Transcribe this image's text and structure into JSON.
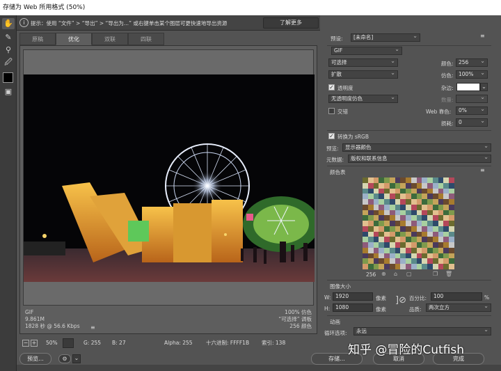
{
  "window": {
    "title": "存储为 Web 所用格式 (50%)"
  },
  "hint": {
    "text": "提示：使用 “文件” > “导出” > “导出为...” 或右键单击某个图层可更快速地导出资源",
    "learn_more": "了解更多"
  },
  "tabs": [
    {
      "label": "原稿"
    },
    {
      "label": "优化"
    },
    {
      "label": "双联"
    },
    {
      "label": "四联"
    }
  ],
  "preview_info": {
    "left": [
      "GIF",
      "9.861M",
      "1828 秒 @ 56.6 Kbps"
    ],
    "right": [
      "100% 仿色",
      "“可选择” 调板",
      "256 颜色"
    ],
    "menu_icon": "menu-icon"
  },
  "status": {
    "zoom": "50%",
    "g": "G: 255",
    "b": "B: 27",
    "alpha": "Alpha: 255",
    "hex": "十六进制: FFFF1B",
    "index": "索引: 138"
  },
  "buttons": {
    "preview": "预览...",
    "save": "存储...",
    "cancel": "取消",
    "done": "完成"
  },
  "settings": {
    "preset_label": "预设:",
    "preset_value": "[未命名]",
    "format": "GIF",
    "reduction": "可选择",
    "colors_label": "颜色:",
    "colors_value": "256",
    "dither_algo": "扩散",
    "dither_label": "仿色:",
    "dither_value": "100%",
    "transparency_label": "透明度",
    "matte_label": "杂边:",
    "trans_dither": "无透明度仿色",
    "amount_label": "数量:",
    "interlaced_label": "交错",
    "web_snap_label": "Web 靠色:",
    "web_snap_value": "0%",
    "lossy_label": "损耗:",
    "lossy_value": "0",
    "srgb_label": "转换为 sRGB",
    "preview_label": "预览:",
    "preview_value": "显示器颜色",
    "metadata_label": "元数据:",
    "metadata_value": "版权和联系信息",
    "color_table_label": "颜色表",
    "color_count": "256",
    "image_size_label": "图像大小",
    "w_label": "W:",
    "w_value": "1920",
    "h_label": "H:",
    "h_value": "1080",
    "px_unit": "像素",
    "percent_label": "百分比:",
    "percent_value": "100",
    "percent_unit": "%",
    "quality_label": "品质:",
    "quality_value": "两次立方",
    "animation_label": "动画",
    "loop_label": "循环选项:",
    "loop_value": "永远"
  },
  "watermark": "知乎 @冒险的Cutfish",
  "palette": [
    "#6b6b2f",
    "#c4a45a",
    "#8e5b7a",
    "#d6d6b0",
    "#3c6b3c",
    "#a77b2e",
    "#5a8a8a",
    "#e2c08f",
    "#4a3a5c",
    "#9bb0c8",
    "#b5485a",
    "#7f9a4c",
    "#c8c8c8",
    "#2e4a6b",
    "#d49a6a",
    "#6a4a2e",
    "#a8d0a0"
  ]
}
